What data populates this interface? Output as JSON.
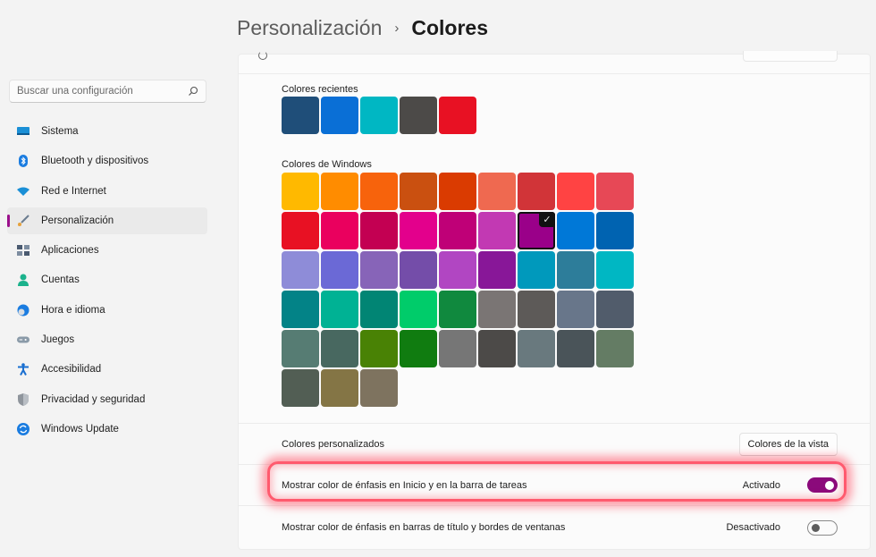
{
  "header": {
    "breadcrumb_parent": "Personalización",
    "breadcrumb_separator": "›",
    "breadcrumb_current": "Colores"
  },
  "sidebar": {
    "search_placeholder": "Buscar una configuración",
    "items": [
      {
        "label": "Sistema",
        "icon": "monitor-icon",
        "color": "#1a8fd6"
      },
      {
        "label": "Bluetooth y dispositivos",
        "icon": "bluetooth-icon",
        "color": "#1a7ce0"
      },
      {
        "label": "Red e Internet",
        "icon": "wifi-icon",
        "color": "#1a8fd6"
      },
      {
        "label": "Personalización",
        "icon": "brush-icon",
        "color": "#e6a23c",
        "active": true
      },
      {
        "label": "Aplicaciones",
        "icon": "apps-icon",
        "color": "#4a5a70"
      },
      {
        "label": "Cuentas",
        "icon": "person-icon",
        "color": "#1bb28c"
      },
      {
        "label": "Hora e idioma",
        "icon": "globe-clock-icon",
        "color": "#1a7ce0"
      },
      {
        "label": "Juegos",
        "icon": "gamepad-icon",
        "color": "#8a9aa8"
      },
      {
        "label": "Accesibilidad",
        "icon": "accessibility-icon",
        "color": "#1a6fd0"
      },
      {
        "label": "Privacidad y seguridad",
        "icon": "shield-icon",
        "color": "#8f959c"
      },
      {
        "label": "Windows Update",
        "icon": "update-icon",
        "color": "#1a7ce0"
      }
    ]
  },
  "colors": {
    "accent": "#8b0a7b",
    "recent_label": "Colores recientes",
    "recent": [
      "#1f4e79",
      "#0a6fd6",
      "#00b7c3",
      "#4c4a48",
      "#e81123"
    ],
    "windows_label": "Colores de Windows",
    "windows": [
      "#ffb900",
      "#ff8c00",
      "#f7630c",
      "#ca5010",
      "#da3b01",
      "#ef6950",
      "#d13438",
      "#ff4343",
      "#e74856",
      "#e81123",
      "#ea005e",
      "#c30052",
      "#e3008c",
      "#bf0077",
      "#c239b3",
      "#9a0089",
      "#0078d7",
      "#0063b1",
      "#8e8cd8",
      "#6b69d6",
      "#8764b8",
      "#744da9",
      "#b146c2",
      "#881798",
      "#0099bc",
      "#2d7d9a",
      "#00b7c3",
      "#038387",
      "#00b294",
      "#018574",
      "#00cc6a",
      "#10893e",
      "#7a7574",
      "#5d5a58",
      "#68768a",
      "#515c6b",
      "#567c73",
      "#486860",
      "#498205",
      "#107c10",
      "#767676",
      "#4c4a48",
      "#69797e",
      "#4a5459",
      "#647c64",
      "#525e54",
      "#847545",
      "#7e735f"
    ],
    "selected_index": 15
  },
  "rows": {
    "custom_label": "Colores personalizados",
    "custom_button": "Colores de la vista",
    "start_taskbar_label": "Mostrar color de énfasis en Inicio y en la barra de tareas",
    "start_taskbar_state": "Activado",
    "start_taskbar_on": true,
    "titlebar_label": "Mostrar color de énfasis en barras de título y bordes de ventanas",
    "titlebar_state": "Desactivado",
    "titlebar_on": false
  }
}
